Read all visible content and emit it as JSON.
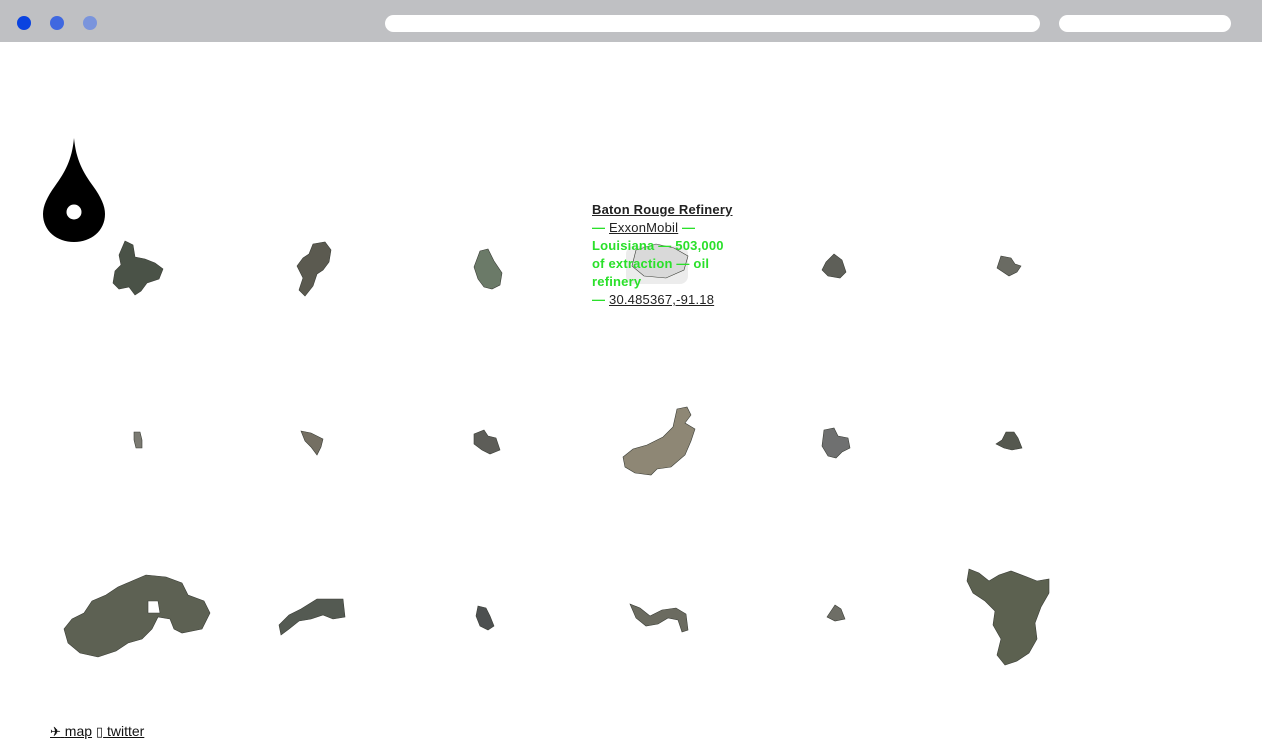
{
  "browser": {
    "dots": [
      "#0a43e0",
      "#3f68e0",
      "#7a94dc"
    ]
  },
  "info_card": {
    "name": "Baton Rouge Refinery",
    "sep1": " — ",
    "operator": "ExxonMobil",
    "sep2": " — ",
    "details": "Louisiana — 503,000 of extraction — oil refinery",
    "sep3": "— ",
    "coordinates": "30.485367,-91.18"
  },
  "sites": [
    {
      "label": "site-1",
      "fill": "#4a5247"
    },
    {
      "label": "site-2",
      "fill": "#5b5a50"
    },
    {
      "label": "site-3",
      "fill": "#6b7a68"
    },
    {
      "label": "site-4",
      "fill": "#d9d9d9"
    },
    {
      "label": "site-5",
      "fill": "#5e5f58"
    },
    {
      "label": "site-6",
      "fill": "#6a6b63"
    },
    {
      "label": "site-7",
      "fill": "#7b7a72"
    },
    {
      "label": "site-8",
      "fill": "#746f63"
    },
    {
      "label": "site-9",
      "fill": "#5d5d58"
    },
    {
      "label": "site-10",
      "fill": "#8e8775"
    },
    {
      "label": "site-11",
      "fill": "#6f7070"
    },
    {
      "label": "site-12",
      "fill": "#55584f"
    },
    {
      "label": "site-13",
      "fill": "#5d6153"
    },
    {
      "label": "site-14",
      "fill": "#545a52"
    },
    {
      "label": "site-15",
      "fill": "#4d5050"
    },
    {
      "label": "site-16",
      "fill": "#6b6b60"
    },
    {
      "label": "site-17",
      "fill": "#6e6e66"
    },
    {
      "label": "site-18",
      "fill": "#5c6150"
    }
  ],
  "footer": {
    "map_icon": "✈",
    "map_label": "map",
    "twitter_icon": "▯",
    "twitter_label": "twitter"
  }
}
